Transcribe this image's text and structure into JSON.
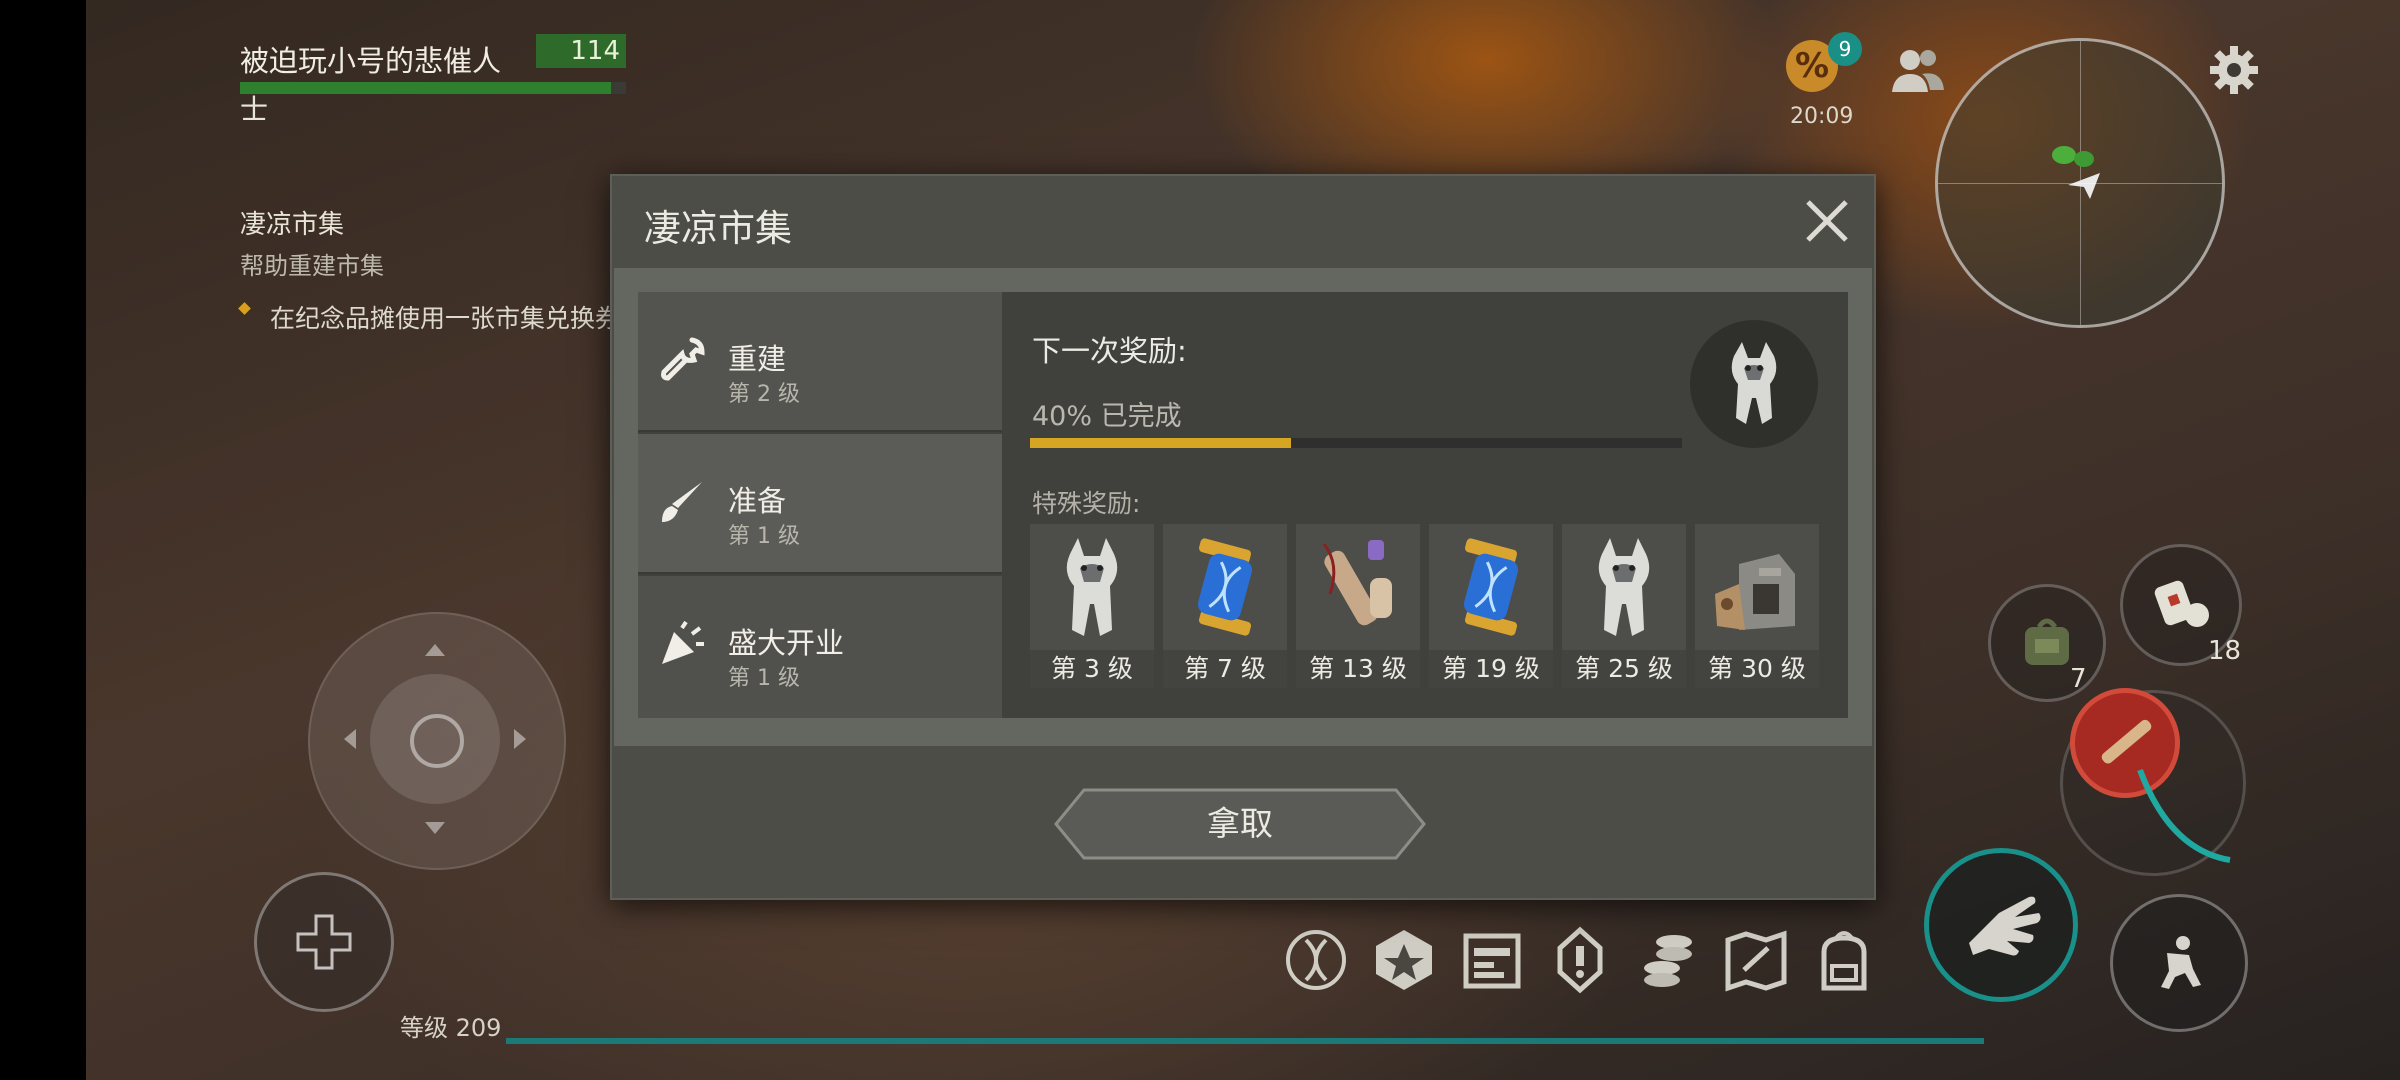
{
  "hud": {
    "player_name": "被迫玩小号的悲催人",
    "player_score": "114",
    "player_sub": "士",
    "quest": {
      "title": "凄凉市集",
      "subtitle": "帮助重建市集",
      "task": "在纪念品摊使用一张市集兑换券"
    },
    "badge_count": "9",
    "clock": "20:09",
    "level_label": "等级 209",
    "slot_left_count": "7",
    "slot_right_count": "18"
  },
  "modal": {
    "title": "凄凉市集",
    "tabs": [
      {
        "name": "重建",
        "level": "第 2 级",
        "icon": "wrench-icon"
      },
      {
        "name": "准备",
        "level": "第 1 级",
        "icon": "brush-icon"
      },
      {
        "name": "盛大开业",
        "level": "第 1 级",
        "icon": "party-popper-icon"
      }
    ],
    "next_reward_label": "下一次奖励:",
    "progress_text": "40% 已完成",
    "progress_value": 0.4,
    "special_label": "特殊奖励:",
    "rewards": [
      {
        "level": "第 3 级",
        "icon": "husky-icon"
      },
      {
        "level": "第 7 级",
        "icon": "dna-capsule-icon"
      },
      {
        "level": "第 13 级",
        "icon": "scroll-icon"
      },
      {
        "level": "第 19 级",
        "icon": "dna-capsule-icon"
      },
      {
        "level": "第 25 级",
        "icon": "husky-icon"
      },
      {
        "level": "第 30 级",
        "icon": "stone-furnace-icon"
      }
    ],
    "claim_label": "拿取"
  },
  "colors": {
    "accent_teal": "#19908a",
    "progress_gold": "#d6a521",
    "hp_green": "#2e7f2e",
    "dna_blue": "#2a6fd6",
    "gold_cap": "#d9a430"
  }
}
